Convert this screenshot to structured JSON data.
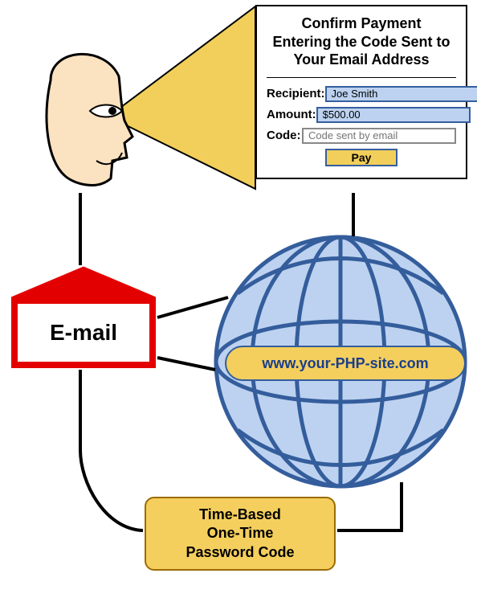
{
  "form": {
    "title_line1": "Confirm Payment",
    "title_line2": "Entering the Code Sent to",
    "title_line3": "Your Email Address",
    "recipient_label": "Recipient:",
    "recipient_value": "Joe Smith",
    "amount_label": "Amount:",
    "amount_value": "$500.00",
    "code_label": "Code:",
    "code_placeholder": "Code sent by email",
    "pay_label": "Pay"
  },
  "email": {
    "label": "E-mail"
  },
  "globe": {
    "url": "www.your-PHP-site.com"
  },
  "totp": {
    "line1": "Time-Based",
    "line2": "One-Time",
    "line3": "Password Code"
  }
}
